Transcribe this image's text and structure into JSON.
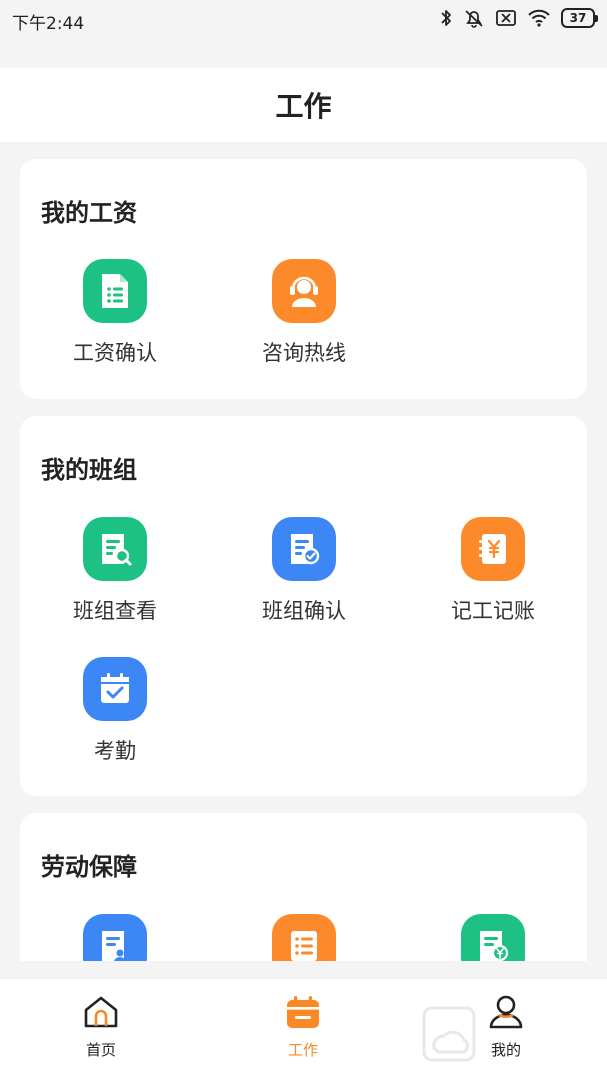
{
  "status_bar": {
    "time": "下午2:44",
    "battery": "37"
  },
  "header": {
    "title": "工作"
  },
  "sections": [
    {
      "title": "我的工资",
      "items": [
        {
          "label": "工资确认",
          "color": "#1cc183",
          "icon": "spreadsheet-icon"
        },
        {
          "label": "咨询热线",
          "color": "#fd8a2a",
          "icon": "headset-support-icon"
        }
      ]
    },
    {
      "title": "我的班组",
      "items": [
        {
          "label": "班组查看",
          "color": "#1cc183",
          "icon": "document-search-icon"
        },
        {
          "label": "班组确认",
          "color": "#3c87f5",
          "icon": "document-check-icon"
        },
        {
          "label": "记工记账",
          "color": "#fd8a2a",
          "icon": "yuan-ledger-icon"
        },
        {
          "label": "考勤",
          "color": "#3c87f5",
          "icon": "calendar-check-icon"
        }
      ]
    },
    {
      "title": "劳动保障",
      "items": [
        {
          "label": "",
          "color": "#3c87f5",
          "icon": "document-person-icon"
        },
        {
          "label": "",
          "color": "#fd8a2a",
          "icon": "list-icon"
        },
        {
          "label": "",
          "color": "#1cc183",
          "icon": "document-yuan-icon"
        }
      ]
    }
  ],
  "bottom_nav": [
    {
      "label": "首页",
      "icon": "home-icon",
      "active": false
    },
    {
      "label": "工作",
      "icon": "calendar-icon",
      "active": true
    },
    {
      "label": "我的",
      "icon": "user-icon",
      "active": false
    }
  ],
  "colors": {
    "accent": "#f78a26",
    "green": "#1cc183",
    "blue": "#3c87f5",
    "orange": "#fd8a2a"
  }
}
